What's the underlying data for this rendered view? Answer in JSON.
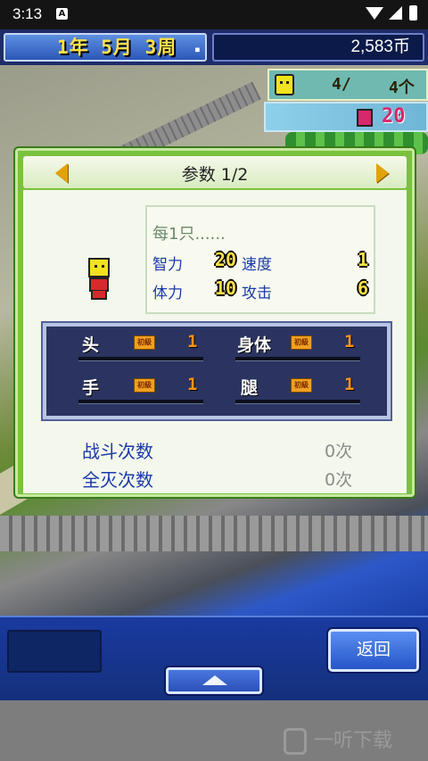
{
  "status_bar": {
    "time": "3:13",
    "notification_icon": "A"
  },
  "game_bar": {
    "date": "1年 5月 3周",
    "money": "2,583币"
  },
  "widgets": {
    "staff_count": "4/",
    "staff_capacity": "4个",
    "book_count": "20"
  },
  "dialog": {
    "title": "参数 1/2",
    "per_one": "每1只......",
    "stats": [
      {
        "label": "智力",
        "value": "20"
      },
      {
        "label": "速度",
        "value": "1"
      },
      {
        "label": "体力",
        "value": "10"
      },
      {
        "label": "攻击",
        "value": "6"
      }
    ],
    "parts": [
      {
        "label": "头",
        "rank": "初級",
        "value": "1"
      },
      {
        "label": "身体",
        "rank": "初級",
        "value": "1"
      },
      {
        "label": "手",
        "rank": "初級",
        "value": "1"
      },
      {
        "label": "腿",
        "rank": "初級",
        "value": "1"
      }
    ],
    "records": [
      {
        "label": "战斗次数",
        "value": "0次"
      },
      {
        "label": "全灭次数",
        "value": "0次"
      }
    ]
  },
  "bottom": {
    "back_label": "返回"
  },
  "watermark": "一听下载"
}
